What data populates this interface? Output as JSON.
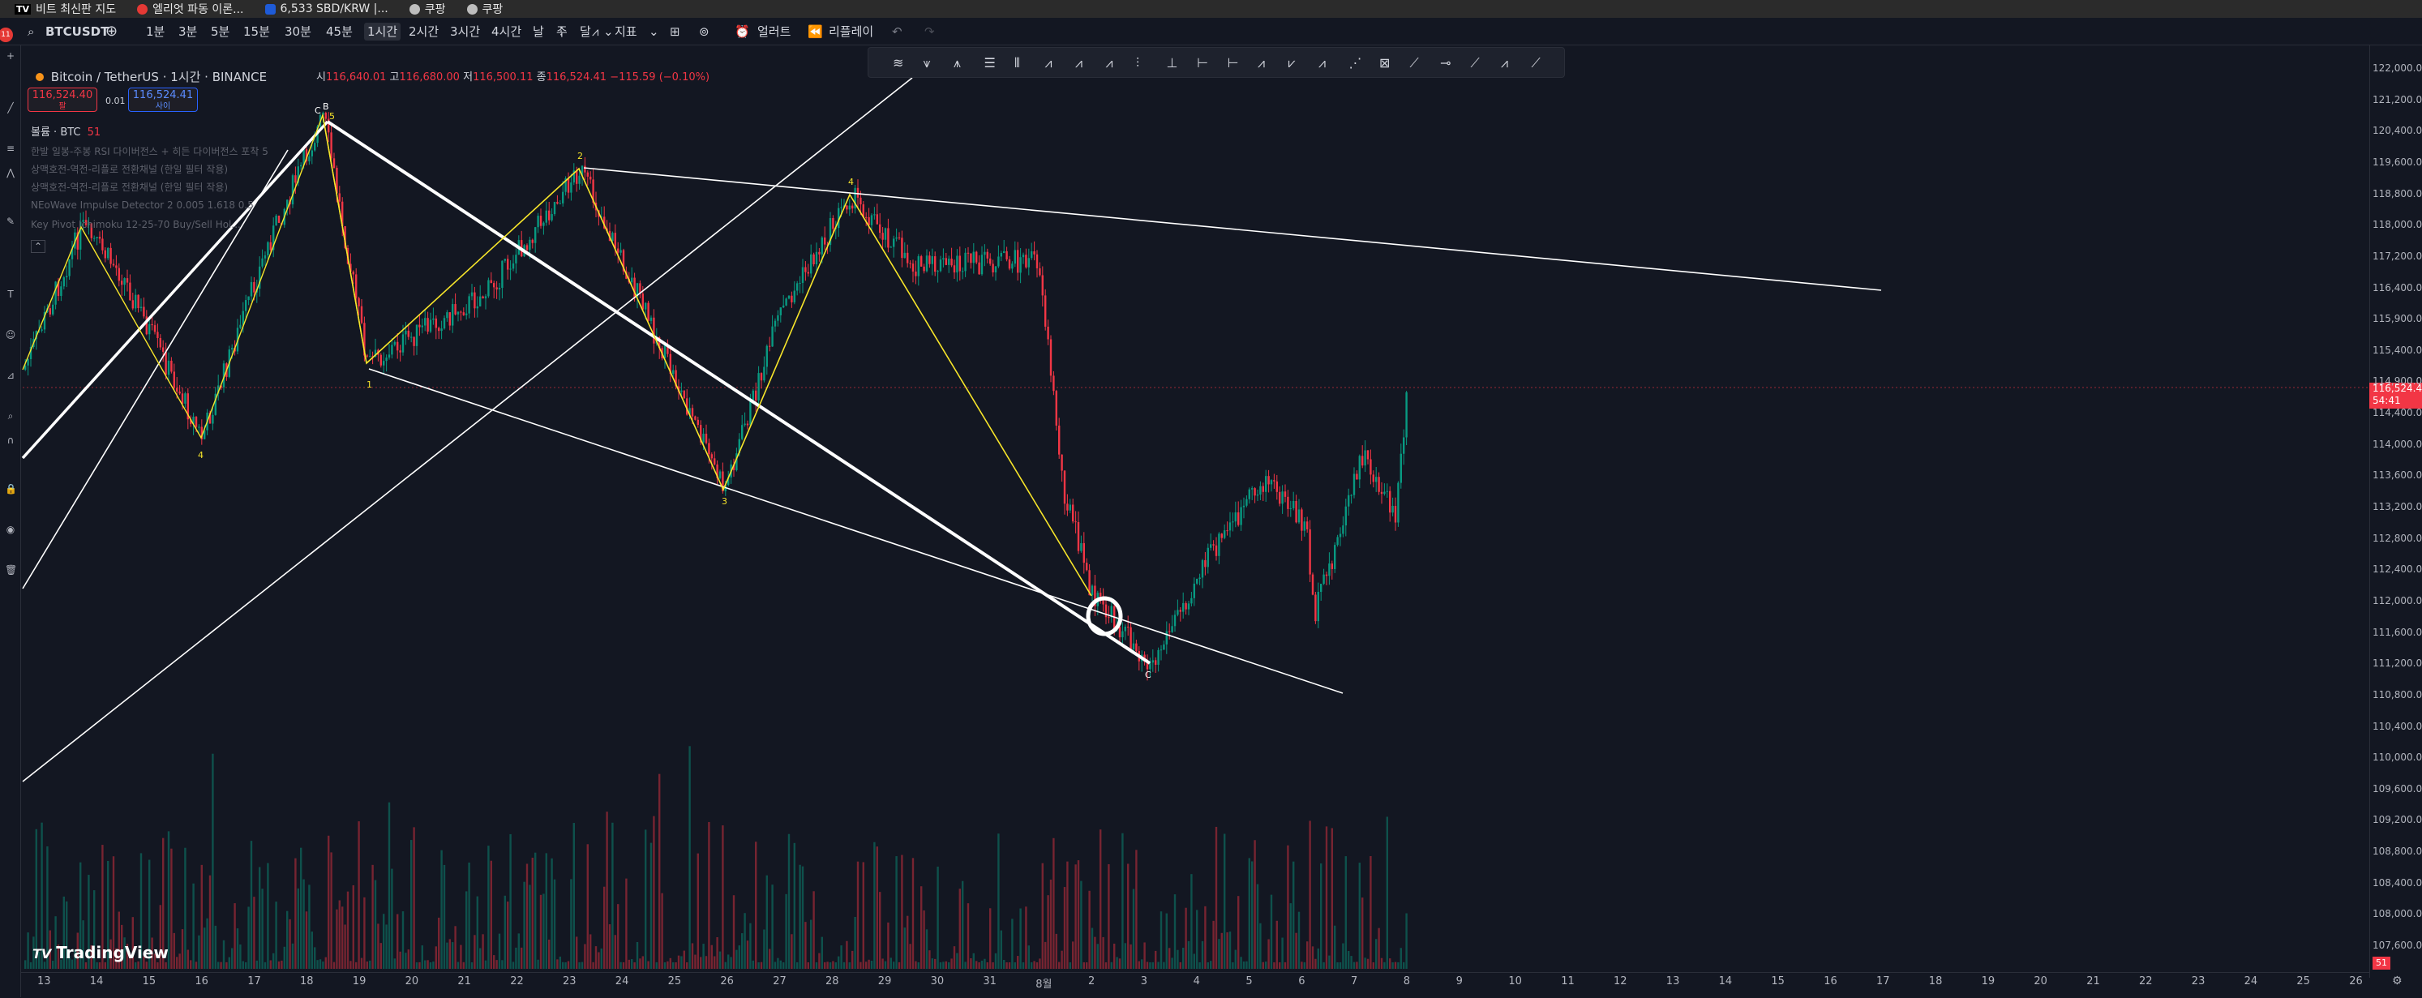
{
  "bookmarks": [
    {
      "label": "비트 최신판 지도",
      "icon": "tv-icon",
      "color": "#000000"
    },
    {
      "label": "엘리엇 파동 이론...",
      "icon": "red-circle-icon",
      "color": "#e53935"
    },
    {
      "label": "6,533 SBD/KRW |...",
      "icon": "blue-logo-icon",
      "color": "#1e5bd8"
    },
    {
      "label": "쿠팡",
      "icon": "globe-icon",
      "color": "#bdbdbd"
    },
    {
      "label": "쿠팡",
      "icon": "globe-icon",
      "color": "#bdbdbd"
    }
  ],
  "toolbar": {
    "symbol": "BTCUSDT",
    "timeframes": [
      "1분",
      "3분",
      "5분",
      "15분",
      "30분",
      "45분",
      "1시간",
      "2시간",
      "3시간",
      "4시간",
      "날",
      "주",
      "달"
    ],
    "active_timeframe": "1시간",
    "indicators_label": "지표",
    "alert_label": "얼러트",
    "replay_label": "리플레이"
  },
  "legend": {
    "title": "Bitcoin / TetherUS · 1시간 · BINANCE",
    "open_label": "시",
    "open": "116,640.01",
    "high_label": "고",
    "high": "116,680.00",
    "low_label": "저",
    "low": "116,500.11",
    "close_label": "종",
    "close": "116,524.41",
    "change": "−115.59 (−0.10%)",
    "sell_price": "116,524.40",
    "sell_label": "팔",
    "buy_price": "116,524.41",
    "buy_label": "사이",
    "spread": "0.01",
    "volume_label": "볼륨 · BTC",
    "volume_value": "51"
  },
  "indicators": [
    "한발 일봉-주봉 RSI 다이버전스 + 히든 다이버전스 포착 5",
    "상맥호전-역전-리플로 전환채널 (한일 필터 작용)",
    "상맥호전-역전-리플로 전환채널 (한일 필터 작용)",
    "NEoWave Impulse Detector 2 0.005 1.618 0.5",
    "Key Pivot Ichimoku 12-25-70 Buy/Sell Hol..."
  ],
  "price_scale": [
    "122,000.00",
    "121,200.00",
    "120,400.00",
    "119,600.00",
    "118,800.00",
    "118,000.00",
    "117,200.00",
    "116,400.00",
    "115,900.00",
    "115,400.00",
    "114,900.00",
    "114,400.00",
    "114,000.00",
    "113,600.00",
    "113,200.00",
    "112,800.00",
    "112,400.00",
    "112,000.00",
    "111,600.00",
    "111,200.00",
    "110,800.00",
    "110,400.00",
    "110,000.00",
    "109,600.00",
    "109,200.00",
    "108,800.00",
    "108,400.00",
    "108,000.00",
    "107,600.00"
  ],
  "last_price": {
    "value": "116,524.41",
    "countdown": "54:41",
    "color": "#f23645"
  },
  "bottom_badge": "51",
  "date_axis": [
    "13",
    "14",
    "15",
    "16",
    "17",
    "18",
    "19",
    "20",
    "21",
    "22",
    "23",
    "24",
    "25",
    "26",
    "27",
    "28",
    "29",
    "30",
    "31",
    "8월",
    "2",
    "3",
    "4",
    "5",
    "6",
    "7",
    "8",
    "9",
    "10",
    "11",
    "12",
    "13",
    "14",
    "15",
    "16",
    "17",
    "18",
    "19",
    "20",
    "21",
    "22",
    "23",
    "24",
    "25",
    "26"
  ],
  "wave_labels": [
    "5",
    "B",
    "C",
    "4",
    "1",
    "2",
    "3",
    "4",
    "C"
  ],
  "logo": "TradingView",
  "colors": {
    "up": "#089981",
    "down": "#f23645",
    "wave": "#f7e52a",
    "trendline": "#ffffff",
    "bg": "#131722"
  }
}
